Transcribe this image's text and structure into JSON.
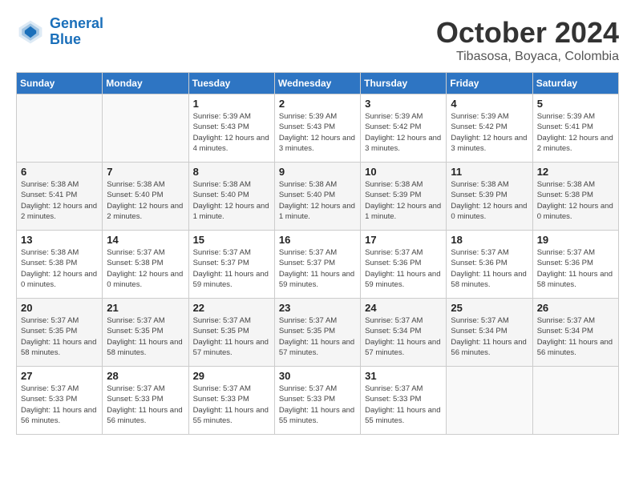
{
  "logo": {
    "line1": "General",
    "line2": "Blue"
  },
  "title": "October 2024",
  "subtitle": "Tibasosa, Boyaca, Colombia",
  "days_of_week": [
    "Sunday",
    "Monday",
    "Tuesday",
    "Wednesday",
    "Thursday",
    "Friday",
    "Saturday"
  ],
  "weeks": [
    [
      {
        "day": "",
        "info": ""
      },
      {
        "day": "",
        "info": ""
      },
      {
        "day": "1",
        "info": "Sunrise: 5:39 AM\nSunset: 5:43 PM\nDaylight: 12 hours and 4 minutes."
      },
      {
        "day": "2",
        "info": "Sunrise: 5:39 AM\nSunset: 5:43 PM\nDaylight: 12 hours and 3 minutes."
      },
      {
        "day": "3",
        "info": "Sunrise: 5:39 AM\nSunset: 5:42 PM\nDaylight: 12 hours and 3 minutes."
      },
      {
        "day": "4",
        "info": "Sunrise: 5:39 AM\nSunset: 5:42 PM\nDaylight: 12 hours and 3 minutes."
      },
      {
        "day": "5",
        "info": "Sunrise: 5:39 AM\nSunset: 5:41 PM\nDaylight: 12 hours and 2 minutes."
      }
    ],
    [
      {
        "day": "6",
        "info": "Sunrise: 5:38 AM\nSunset: 5:41 PM\nDaylight: 12 hours and 2 minutes."
      },
      {
        "day": "7",
        "info": "Sunrise: 5:38 AM\nSunset: 5:40 PM\nDaylight: 12 hours and 2 minutes."
      },
      {
        "day": "8",
        "info": "Sunrise: 5:38 AM\nSunset: 5:40 PM\nDaylight: 12 hours and 1 minute."
      },
      {
        "day": "9",
        "info": "Sunrise: 5:38 AM\nSunset: 5:40 PM\nDaylight: 12 hours and 1 minute."
      },
      {
        "day": "10",
        "info": "Sunrise: 5:38 AM\nSunset: 5:39 PM\nDaylight: 12 hours and 1 minute."
      },
      {
        "day": "11",
        "info": "Sunrise: 5:38 AM\nSunset: 5:39 PM\nDaylight: 12 hours and 0 minutes."
      },
      {
        "day": "12",
        "info": "Sunrise: 5:38 AM\nSunset: 5:38 PM\nDaylight: 12 hours and 0 minutes."
      }
    ],
    [
      {
        "day": "13",
        "info": "Sunrise: 5:38 AM\nSunset: 5:38 PM\nDaylight: 12 hours and 0 minutes."
      },
      {
        "day": "14",
        "info": "Sunrise: 5:37 AM\nSunset: 5:38 PM\nDaylight: 12 hours and 0 minutes."
      },
      {
        "day": "15",
        "info": "Sunrise: 5:37 AM\nSunset: 5:37 PM\nDaylight: 11 hours and 59 minutes."
      },
      {
        "day": "16",
        "info": "Sunrise: 5:37 AM\nSunset: 5:37 PM\nDaylight: 11 hours and 59 minutes."
      },
      {
        "day": "17",
        "info": "Sunrise: 5:37 AM\nSunset: 5:36 PM\nDaylight: 11 hours and 59 minutes."
      },
      {
        "day": "18",
        "info": "Sunrise: 5:37 AM\nSunset: 5:36 PM\nDaylight: 11 hours and 58 minutes."
      },
      {
        "day": "19",
        "info": "Sunrise: 5:37 AM\nSunset: 5:36 PM\nDaylight: 11 hours and 58 minutes."
      }
    ],
    [
      {
        "day": "20",
        "info": "Sunrise: 5:37 AM\nSunset: 5:35 PM\nDaylight: 11 hours and 58 minutes."
      },
      {
        "day": "21",
        "info": "Sunrise: 5:37 AM\nSunset: 5:35 PM\nDaylight: 11 hours and 58 minutes."
      },
      {
        "day": "22",
        "info": "Sunrise: 5:37 AM\nSunset: 5:35 PM\nDaylight: 11 hours and 57 minutes."
      },
      {
        "day": "23",
        "info": "Sunrise: 5:37 AM\nSunset: 5:35 PM\nDaylight: 11 hours and 57 minutes."
      },
      {
        "day": "24",
        "info": "Sunrise: 5:37 AM\nSunset: 5:34 PM\nDaylight: 11 hours and 57 minutes."
      },
      {
        "day": "25",
        "info": "Sunrise: 5:37 AM\nSunset: 5:34 PM\nDaylight: 11 hours and 56 minutes."
      },
      {
        "day": "26",
        "info": "Sunrise: 5:37 AM\nSunset: 5:34 PM\nDaylight: 11 hours and 56 minutes."
      }
    ],
    [
      {
        "day": "27",
        "info": "Sunrise: 5:37 AM\nSunset: 5:33 PM\nDaylight: 11 hours and 56 minutes."
      },
      {
        "day": "28",
        "info": "Sunrise: 5:37 AM\nSunset: 5:33 PM\nDaylight: 11 hours and 56 minutes."
      },
      {
        "day": "29",
        "info": "Sunrise: 5:37 AM\nSunset: 5:33 PM\nDaylight: 11 hours and 55 minutes."
      },
      {
        "day": "30",
        "info": "Sunrise: 5:37 AM\nSunset: 5:33 PM\nDaylight: 11 hours and 55 minutes."
      },
      {
        "day": "31",
        "info": "Sunrise: 5:37 AM\nSunset: 5:33 PM\nDaylight: 11 hours and 55 minutes."
      },
      {
        "day": "",
        "info": ""
      },
      {
        "day": "",
        "info": ""
      }
    ]
  ]
}
